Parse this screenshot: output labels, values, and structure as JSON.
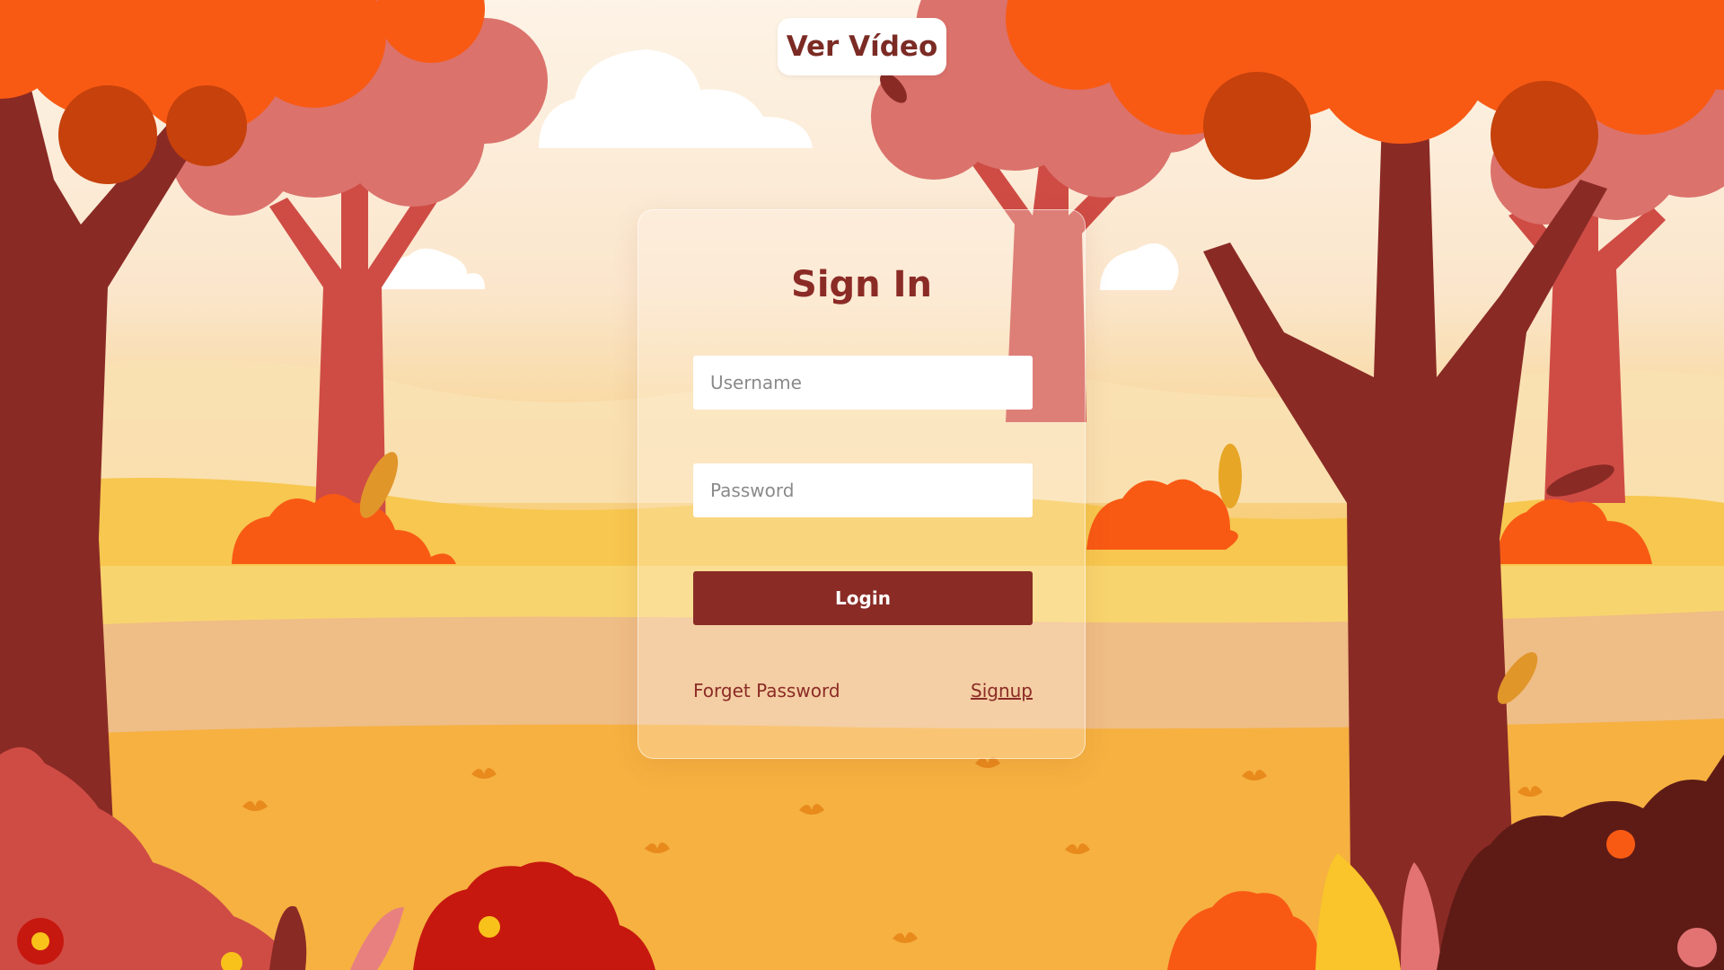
{
  "header": {
    "video_button_label": "Ver Vídeo"
  },
  "login_card": {
    "title": "Sign In",
    "username_placeholder": "Username",
    "password_placeholder": "Password",
    "login_label": "Login",
    "forgot_label": "Forget Password",
    "signup_label": "Signup"
  },
  "colors": {
    "accent": "#8a2b26",
    "tree_orange": "#f85a14",
    "tree_pink": "#db726c",
    "trunk": "#8a2a25",
    "grass": "#f7c753"
  }
}
